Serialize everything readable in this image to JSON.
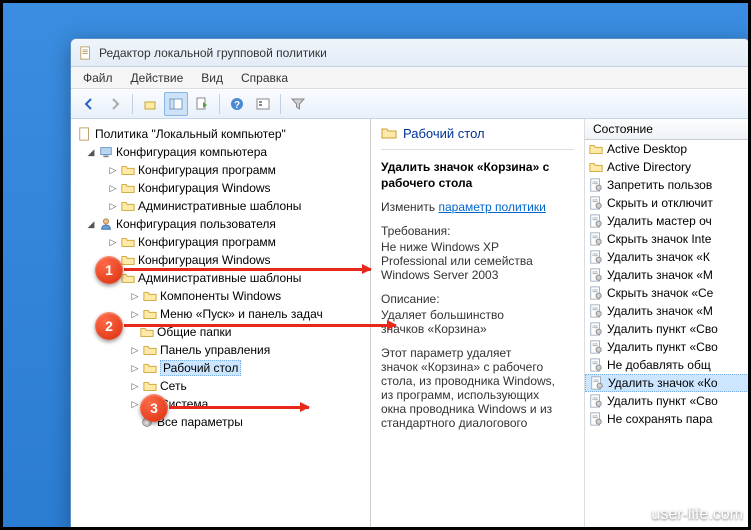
{
  "window": {
    "title": "Редактор локальной групповой политики"
  },
  "menu": {
    "file": "Файл",
    "action": "Действие",
    "view": "Вид",
    "help": "Справка"
  },
  "tree": {
    "root": "Политика \"Локальный компьютер\"",
    "comp_config": "Конфигурация компьютера",
    "comp_soft": "Конфигурация программ",
    "comp_win": "Конфигурация Windows",
    "comp_admin": "Административные шаблоны",
    "user_config": "Конфигурация пользователя",
    "user_soft": "Конфигурация программ",
    "user_win": "Конфигурация Windows",
    "user_admin": "Административные шаблоны",
    "win_components": "Компоненты Windows",
    "start_menu": "Меню «Пуск» и панель задач",
    "shared_folders": "Общие папки",
    "control_panel": "Панель управления",
    "desktop": "Рабочий стол",
    "network": "Сеть",
    "system": "Система",
    "all_params": "Все параметры"
  },
  "detail": {
    "header": "Рабочий стол",
    "title_l1": "Удалить значок «Корзина» с",
    "title_l2": "рабочего стола",
    "edit_label": "Изменить",
    "edit_link": "параметр политики",
    "req_label": "Требования:",
    "req_l1": "Не ниже Windows XP",
    "req_l2": "Professional или семейства",
    "req_l3": "Windows Server 2003",
    "desc_label": "Описание:",
    "desc_l1": "Удаляет большинство",
    "desc_l2": "значков «Корзина»",
    "para_l1": "Этот параметр удаляет",
    "para_l2": "значок «Корзина» с рабочего",
    "para_l3": "стола, из проводника Windows,",
    "para_l4": "из программ, использующих",
    "para_l5": "окна проводника Windows и из",
    "para_l6": "стандартного диалогового"
  },
  "right": {
    "col": "Состояние",
    "items": [
      {
        "type": "folder",
        "label": "Active Desktop"
      },
      {
        "type": "folder",
        "label": "Active Directory"
      },
      {
        "type": "setting",
        "label": "Запретить пользов"
      },
      {
        "type": "setting",
        "label": "Скрыть и отключит"
      },
      {
        "type": "setting",
        "label": "Удалить мастер оч"
      },
      {
        "type": "setting",
        "label": "Скрыть значок Inte"
      },
      {
        "type": "setting",
        "label": "Удалить значок «К"
      },
      {
        "type": "setting",
        "label": "Удалить значок «М"
      },
      {
        "type": "setting",
        "label": "Скрыть значок «Се"
      },
      {
        "type": "setting",
        "label": "Удалить значок «М"
      },
      {
        "type": "setting",
        "label": "Удалить пункт «Сво"
      },
      {
        "type": "setting",
        "label": "Удалить пункт «Сво"
      },
      {
        "type": "setting",
        "label": "Не добавлять общ"
      },
      {
        "type": "setting",
        "label": "Удалить значок «Ко",
        "selected": true
      },
      {
        "type": "setting",
        "label": "Удалить пункт «Сво"
      },
      {
        "type": "setting",
        "label": "Не сохранять пара"
      }
    ]
  },
  "callouts": {
    "c1": "1",
    "c2": "2",
    "c3": "3"
  },
  "watermark": "user-life.com"
}
